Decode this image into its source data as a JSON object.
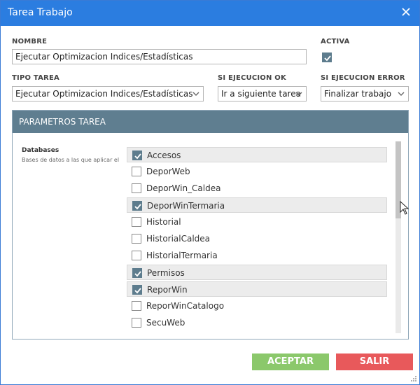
{
  "window": {
    "title": "Tarea Trabajo"
  },
  "fields": {
    "nombre": {
      "label": "NOMBRE",
      "value": "Ejecutar Optimizacion Indices/Estadísticas"
    },
    "activa": {
      "label": "ACTIVA",
      "checked": true
    },
    "tipo_tarea": {
      "label": "TIPO TAREA",
      "value": "Ejecutar Optimizacion Indices/Estadísticas"
    },
    "si_ejecucion_ok": {
      "label": "SI EJECUCION OK",
      "value": "Ir a siguiente tarea"
    },
    "si_ejecucion_error": {
      "label": "SI EJECUCION ERROR",
      "value": "Finalizar trabajo"
    }
  },
  "parametros": {
    "header": "PARAMETROS TAREA",
    "databases_label": "Databases",
    "databases_desc": "Bases de datos a las que aplicar el m",
    "items": [
      {
        "label": "Accesos",
        "checked": true
      },
      {
        "label": "DeporWeb",
        "checked": false
      },
      {
        "label": "DeporWin_Caldea",
        "checked": false
      },
      {
        "label": "DeporWinTermaria",
        "checked": true
      },
      {
        "label": "Historial",
        "checked": false
      },
      {
        "label": "HistorialCaldea",
        "checked": false
      },
      {
        "label": "HistorialTermaria",
        "checked": false
      },
      {
        "label": "Permisos",
        "checked": true
      },
      {
        "label": "ReporWin",
        "checked": true
      },
      {
        "label": "ReporWinCatalogo",
        "checked": false
      },
      {
        "label": "SecuWeb",
        "checked": false
      }
    ]
  },
  "buttons": {
    "accept": "ACEPTAR",
    "exit": "SALIR"
  },
  "colors": {
    "titlebar": "#2b7de0",
    "panel_header": "#5f7e90",
    "accept": "#8bc86b",
    "exit": "#e8595b",
    "checked": "#5d7c8d"
  }
}
